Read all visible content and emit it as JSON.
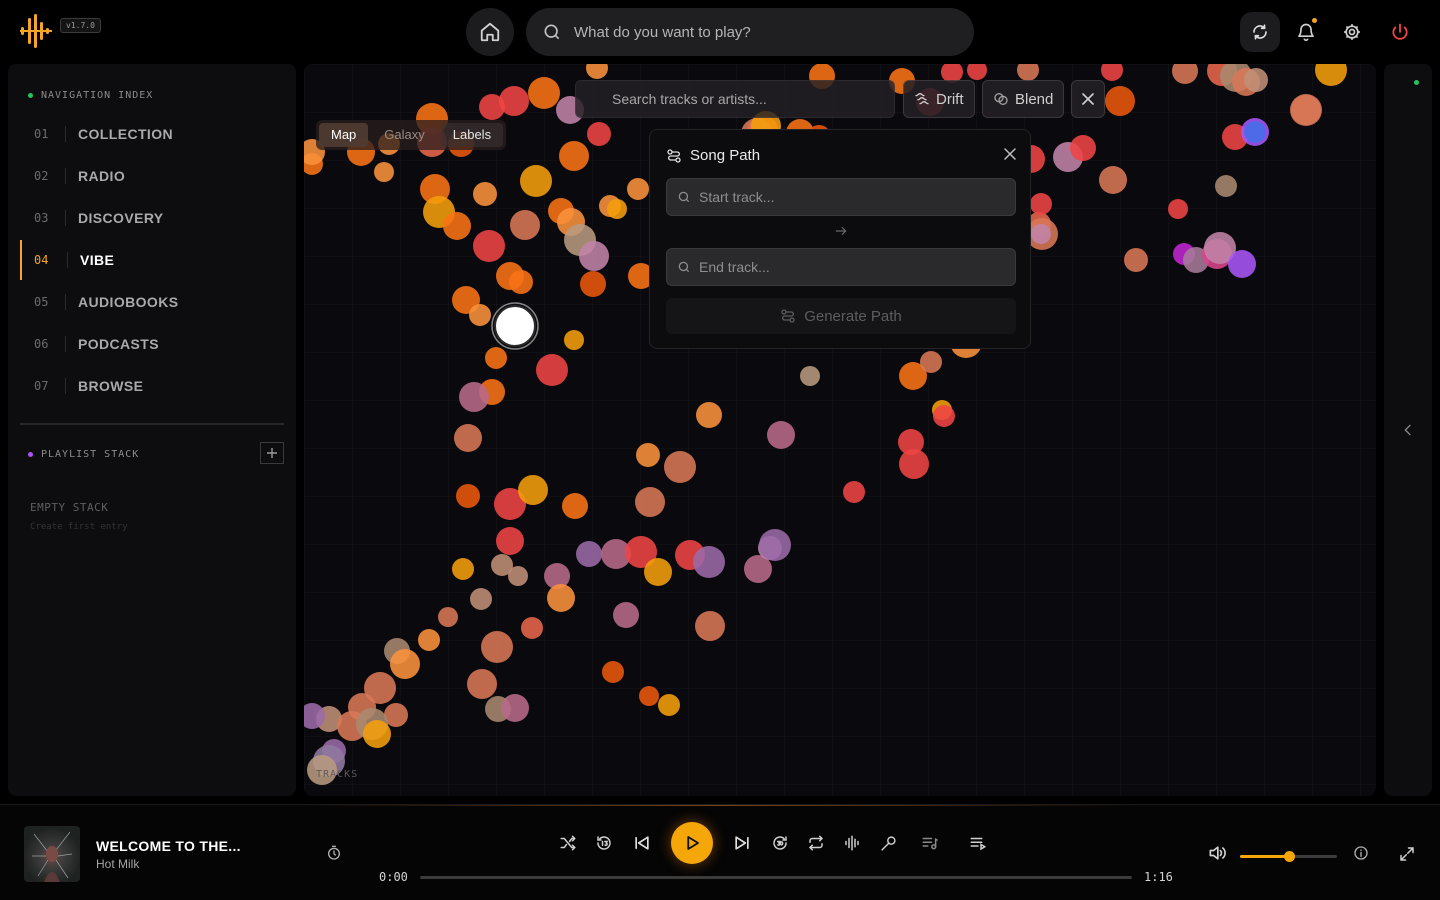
{
  "app": {
    "version": "v1.7.0",
    "search_placeholder": "What do you want to play?",
    "colors": {
      "accent": "#f5a623",
      "power": "#ef4444",
      "status_online": "#22c55e",
      "playlist_dot": "#a855f7"
    }
  },
  "header": {
    "icons": [
      "home-icon",
      "search-icon",
      "sync-icon",
      "bell-icon",
      "gear-icon",
      "power-icon"
    ]
  },
  "sidebar": {
    "nav_label": "NAVIGATION INDEX",
    "items": [
      {
        "num": "01",
        "label": "COLLECTION"
      },
      {
        "num": "02",
        "label": "RADIO"
      },
      {
        "num": "03",
        "label": "DISCOVERY"
      },
      {
        "num": "04",
        "label": "VIBE",
        "active": true
      },
      {
        "num": "05",
        "label": "AUDIOBOOKS"
      },
      {
        "num": "06",
        "label": "PODCASTS"
      },
      {
        "num": "07",
        "label": "BROWSE"
      }
    ],
    "playlist_label": "PLAYLIST STACK",
    "empty_title": "EMPTY STACK",
    "empty_sub": "Create first entry"
  },
  "vibe": {
    "tabs": [
      "Map",
      "Galaxy",
      "Labels"
    ],
    "active_tab": "Map",
    "track_search_placeholder": "Search tracks or artists...",
    "drift_label": "Drift",
    "blend_label": "Blend",
    "tracks_count_label": "TRACKS",
    "song_path": {
      "title": "Song Path",
      "start_placeholder": "Start track...",
      "end_placeholder": "End track...",
      "generate_label": "Generate Path"
    }
  },
  "player": {
    "title": "WELCOME TO THE...",
    "artist": "Hot Milk",
    "elapsed": "0:00",
    "duration": "1:16",
    "progress": 0,
    "volume": 0.5
  }
}
